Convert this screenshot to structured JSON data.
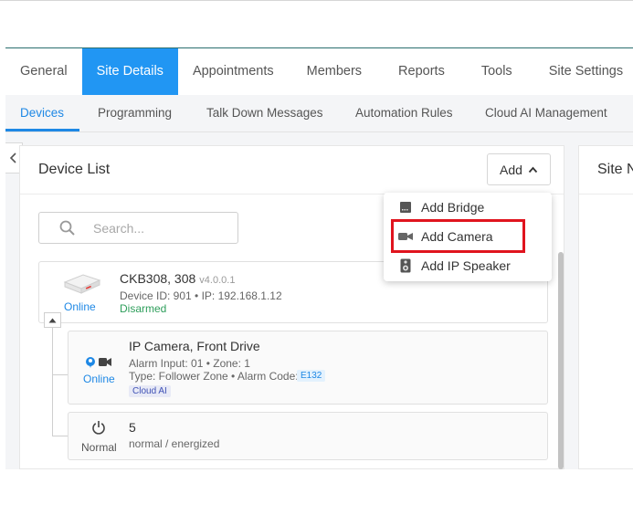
{
  "main_tabs": [
    "General",
    "Site Details",
    "Appointments",
    "Members",
    "Reports",
    "Tools",
    "Site Settings"
  ],
  "sub_tabs": [
    "Devices",
    "Programming",
    "Talk Down Messages",
    "Automation Rules",
    "Cloud AI Management"
  ],
  "device_list": {
    "title": "Device List",
    "add_label": "Add",
    "search_placeholder": "Search..."
  },
  "side_panel": {
    "title": "Site N"
  },
  "add_menu": {
    "items": [
      {
        "label": "Add Bridge",
        "icon": "bridge-icon"
      },
      {
        "label": "Add Camera",
        "icon": "camera-icon",
        "highlighted": true
      },
      {
        "label": "Add IP Speaker",
        "icon": "speaker-icon"
      }
    ]
  },
  "devices": [
    {
      "name": "CKB308, 308",
      "version": "v4.0.0.1",
      "status": "Online",
      "details": "Device ID: 901 • IP: 192.168.1.12",
      "state": "Disarmed",
      "children": [
        {
          "name": "IP Camera, Front Drive",
          "status": "Online",
          "line1": "Alarm Input: 01 • Zone: 1",
          "line2": "Type: Follower Zone • Alarm Code:",
          "code_badge": "E132",
          "ai_badge": "Cloud AI"
        },
        {
          "name": "5",
          "status": "Normal",
          "line1": "normal / energized"
        }
      ]
    }
  ],
  "colors": {
    "primary": "#2196f3",
    "online": "#1e88e5",
    "disarmed": "#2e9e5b",
    "highlight": "#e0141e"
  }
}
